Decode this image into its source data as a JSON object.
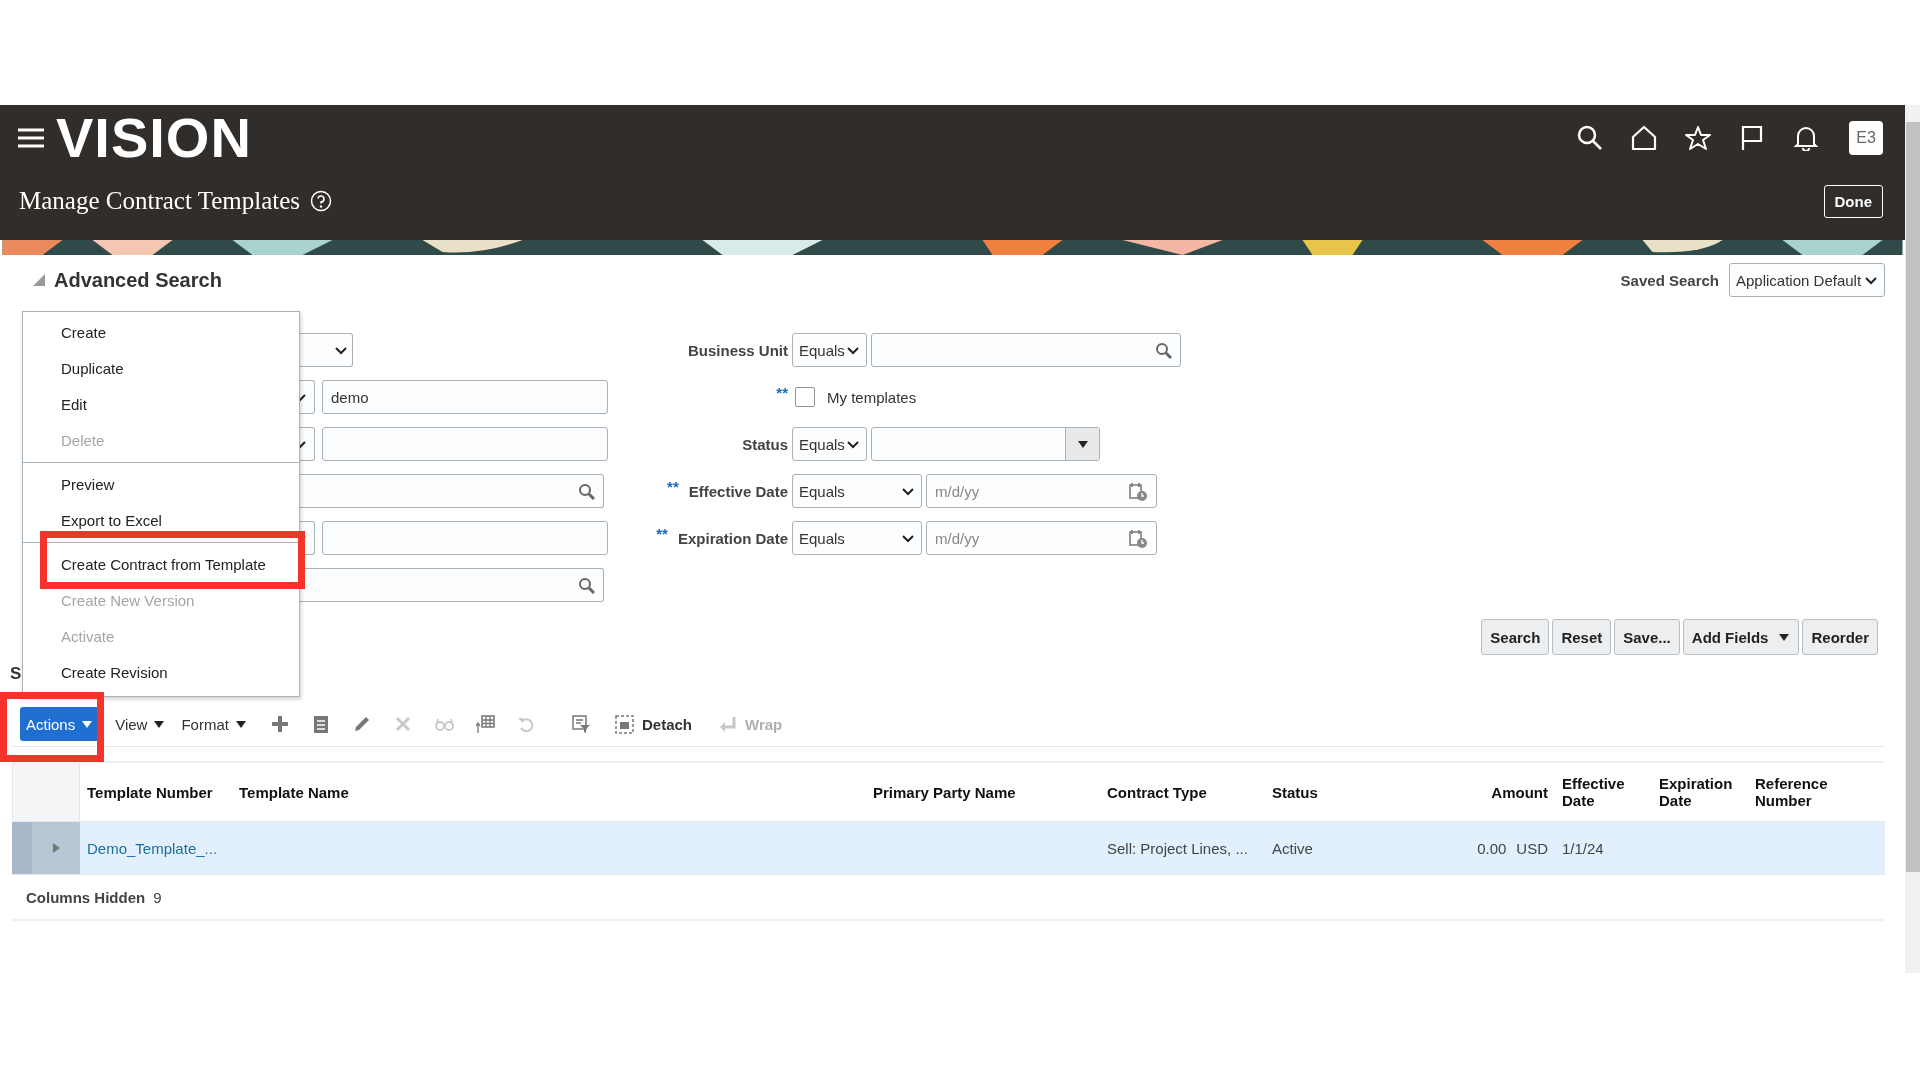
{
  "header": {
    "logo": "VISION",
    "avatar": "E3",
    "title": "Manage Contract Templates",
    "done_button": "Done"
  },
  "search": {
    "title": "Advanced Search",
    "expanded": true,
    "saved_search_label": "Saved Search",
    "saved_search_value": "Application Default",
    "left_fields": [
      {
        "kind": "select"
      },
      {
        "kind": "text",
        "value": "demo"
      },
      {
        "kind": "text"
      },
      {
        "kind": "lookup"
      },
      {
        "kind": "text"
      },
      {
        "kind": "lookup"
      }
    ],
    "right_fields": [
      {
        "kind": "lookup",
        "label": "Business Unit",
        "operator": "Equals"
      },
      {
        "kind": "checkbox",
        "marker": "**",
        "label": "My templates",
        "checked": false
      },
      {
        "kind": "choice",
        "label": "Status",
        "operator": "Equals"
      },
      {
        "kind": "date",
        "marker": "**",
        "label": "Effective Date",
        "operator": "Equals",
        "placeholder": "m/d/yy"
      },
      {
        "kind": "date",
        "marker": "**",
        "label": "Expiration Date",
        "operator": "Equals",
        "placeholder": "m/d/yy"
      }
    ],
    "buttons": [
      {
        "label": "Search",
        "has_menu": false
      },
      {
        "label": "Reset",
        "has_menu": false
      },
      {
        "label": "Save...",
        "has_menu": false
      },
      {
        "label": "Add Fields",
        "has_menu": true
      },
      {
        "label": "Reorder",
        "has_menu": false
      }
    ]
  },
  "results_heading": "S",
  "actions_menu": {
    "items": [
      {
        "label": "Create",
        "disabled": false,
        "separator_before": false
      },
      {
        "label": "Duplicate",
        "disabled": false,
        "separator_before": false
      },
      {
        "label": "Edit",
        "disabled": false,
        "separator_before": false
      },
      {
        "label": "Delete",
        "disabled": true,
        "separator_before": false
      },
      {
        "label": "Preview",
        "disabled": false,
        "separator_before": true
      },
      {
        "label": "Export to Excel",
        "disabled": false,
        "separator_before": false
      },
      {
        "label": "Create Contract from Template",
        "disabled": false,
        "separator_before": true
      },
      {
        "label": "Create New Version",
        "disabled": true,
        "separator_before": false
      },
      {
        "label": "Activate",
        "disabled": true,
        "separator_before": false
      },
      {
        "label": "Create Revision",
        "disabled": false,
        "separator_before": false
      }
    ]
  },
  "toolbar": {
    "menus": [
      {
        "label": "Actions",
        "primary": true
      },
      {
        "label": "View",
        "primary": false
      },
      {
        "label": "Format",
        "primary": false
      }
    ],
    "icons": [
      {
        "disabled": false
      },
      {
        "disabled": false
      },
      {
        "disabled": false
      },
      {
        "disabled": true
      },
      {
        "disabled": true
      },
      {
        "disabled": false
      },
      {
        "disabled": true
      },
      {
        "disabled": false
      }
    ],
    "text_buttons": [
      {
        "label": "Detach",
        "disabled": false
      },
      {
        "label": "Wrap",
        "disabled": true
      }
    ]
  },
  "table": {
    "columns": [
      "Template Number",
      "Template Name",
      "Primary Party Name",
      "Contract Type",
      "Status",
      "Amount",
      "Effective Date",
      "Expiration Date",
      "Reference Number"
    ],
    "rows": [
      {
        "selected": true,
        "expanded": false,
        "cells": [
          "Demo_Template_...",
          "",
          "",
          "Sell: Project Lines, ...",
          "Active",
          "0.00",
          "1/1/24",
          "",
          ""
        ],
        "currency": "USD"
      }
    ],
    "columns_hidden_label": "Columns Hidden",
    "columns_hidden_count": "9"
  }
}
